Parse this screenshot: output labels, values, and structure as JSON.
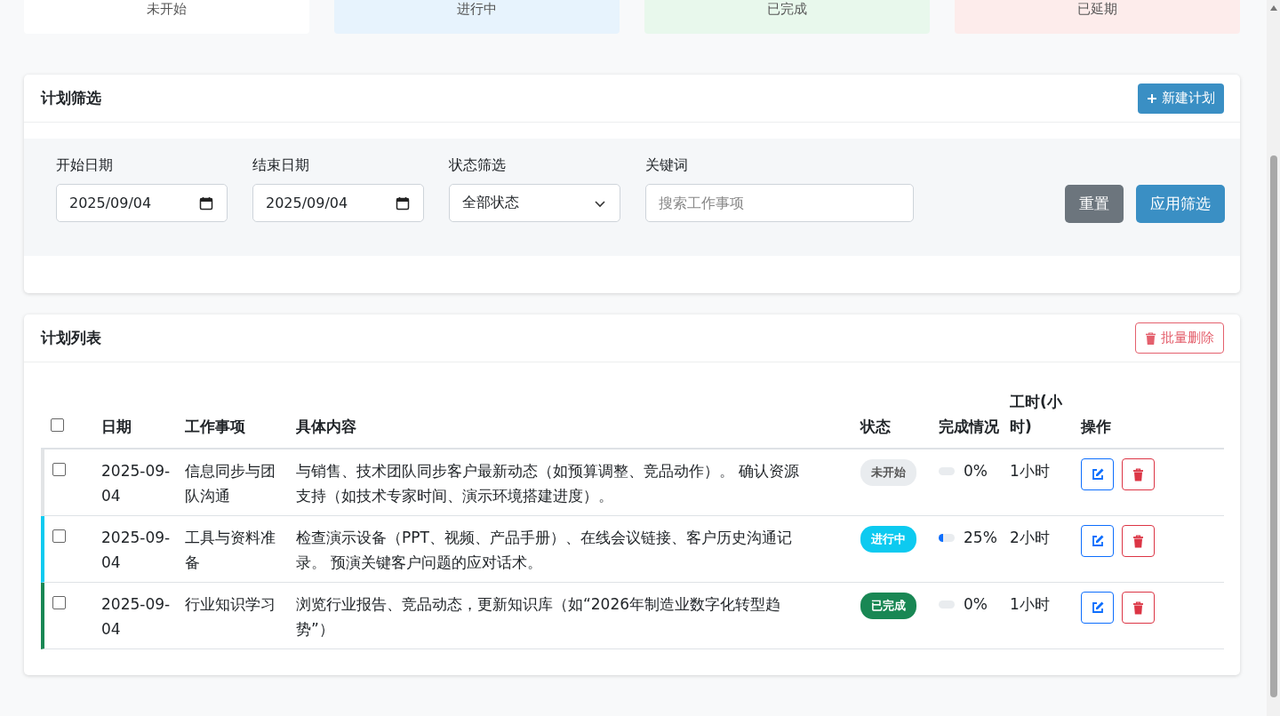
{
  "summary_cards": [
    {
      "label": "未开始",
      "kind": "not_started"
    },
    {
      "label": "进行中",
      "kind": "in_progress"
    },
    {
      "label": "已完成",
      "kind": "done"
    },
    {
      "label": "已延期",
      "kind": "delayed"
    }
  ],
  "filter_panel": {
    "title": "计划筛选",
    "new_button": "新建计划",
    "fields": [
      {
        "kind": "date",
        "label": "开始日期",
        "value": "2025/09/04"
      },
      {
        "kind": "date",
        "label": "结束日期",
        "value": "2025/09/04"
      },
      {
        "kind": "select",
        "label": "状态筛选",
        "value": "全部状态"
      },
      {
        "kind": "text",
        "label": "关键词",
        "placeholder": "搜索工作事项"
      }
    ],
    "reset_button": "重置",
    "apply_button": "应用筛选"
  },
  "plan_list": {
    "title": "计划列表",
    "batch_delete_button": "批量删除",
    "select_all_checked": false,
    "columns": [
      "日期",
      "工作事项",
      "具体内容",
      "状态",
      "完成情况",
      "工时(小时)",
      "操作"
    ],
    "rows": [
      {
        "checked": false,
        "date": "2025-09-04",
        "item": "信息同步与团队沟通",
        "content": "与销售、技术团队同步客户最新动态（如预算调整、竞品动作）。 确认资源支持（如技术专家时间、演示环境搭建进度）。",
        "kind": "not_started",
        "status_label": "未开始",
        "level": 0,
        "progress": "0%",
        "hours": "1小时"
      },
      {
        "checked": false,
        "date": "2025-09-04",
        "item": "工具与资料准备",
        "content": "检查演示设备（PPT、视频、产品手册）、在线会议链接、客户历史沟通记录。 预演关键客户问题的应对话术。",
        "kind": "in_progress",
        "status_label": "进行中",
        "level": 0.25,
        "progress": "25%",
        "hours": "2小时"
      },
      {
        "checked": false,
        "date": "2025-09-04",
        "item": "行业知识学习",
        "content": "浏览行业报告、竞品动态，更新知识库（如“2026年制造业数字化转型趋势”）",
        "kind": "done",
        "status_label": "已完成",
        "level": 0,
        "progress": "0%",
        "hours": "1小时"
      }
    ]
  }
}
